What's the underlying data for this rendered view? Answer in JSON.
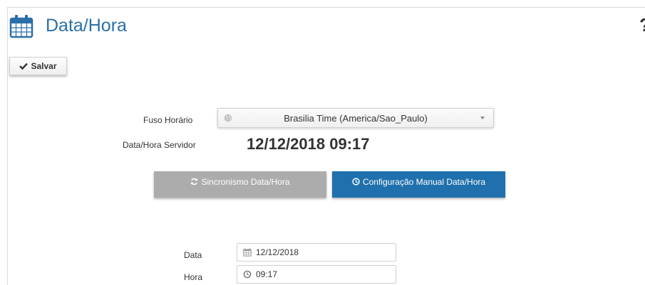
{
  "header": {
    "title": "Data/Hora",
    "title_icon": "calendar-icon",
    "help_icon": "question-icon",
    "help_text": "?"
  },
  "toolbar": {
    "save_label": "Salvar",
    "save_icon": "check-icon"
  },
  "form": {
    "timezone_label": "Fuso Horário",
    "timezone_value": "Brasilia Time (America/Sao_Paulo)",
    "server_time_label": "Data/Hora Servidor",
    "server_time_value": "12/12/2018 09:17",
    "sync_button_label": "Sincronismo Data/Hora",
    "manual_button_label": "Configuração Manual Data/Hora",
    "date_label": "Data",
    "date_value": "12/12/2018",
    "time_label": "Hora",
    "time_value": "09:17"
  },
  "colors": {
    "title": "#2a6fa8",
    "manual_button": "#1f70ad",
    "sync_button": "#acacac"
  }
}
